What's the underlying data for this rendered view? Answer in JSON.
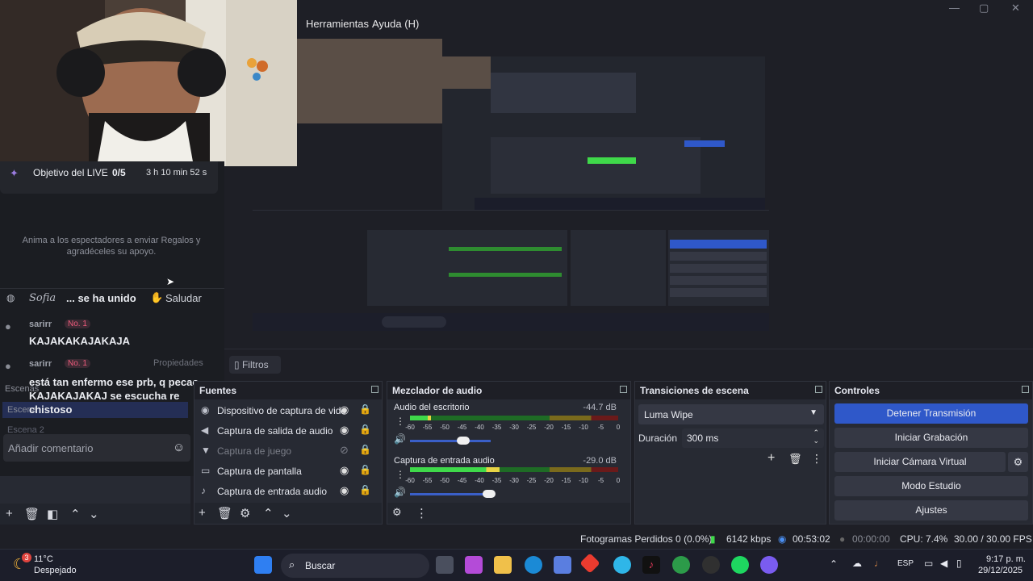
{
  "window": {
    "menu": [
      "Herramientas",
      "Ayuda (H)"
    ],
    "controls": [
      "—",
      "▢",
      "✕"
    ]
  },
  "chat": {
    "goal_label": "Objetivo del LIVE",
    "goal_progress": "0/5",
    "goal_timer": "3 h 10 min 52 s",
    "gift_prompt": "Anima a los espectadores a enviar Regalos y agradéceles su apoyo.",
    "joined_user": "Sofia",
    "joined_text": "... se ha unido",
    "greet_button": "Saludar",
    "messages": [
      {
        "user": "sarirr",
        "badge": "No. 1",
        "text": "KAJAKAKAJAKAJA"
      },
      {
        "user": "sarirr",
        "badge": "No. 1",
        "text": "está tan enfermo ese prb, q pecao KAJAKAJAKAJ se escucha re chistoso"
      }
    ],
    "comment_placeholder": "Añadir comentario",
    "hidden_labels": {
      "scenes": "Escenas",
      "scene1": "Escena",
      "scene2": "Escena 2",
      "properties": "Propiedades"
    }
  },
  "filtros": {
    "label": "Filtros"
  },
  "sources": {
    "title": "Fuentes",
    "items": [
      {
        "label": "Dispositivo de captura de vide",
        "icon": "camera-icon"
      },
      {
        "label": "Captura de salida de audio",
        "icon": "speaker-icon"
      },
      {
        "label": "Captura de juego",
        "icon": "gamepad-icon"
      },
      {
        "label": "Captura de pantalla",
        "icon": "monitor-icon"
      },
      {
        "label": "Captura de entrada audio",
        "icon": "mic-icon"
      }
    ]
  },
  "mixer": {
    "title": "Mezclador de audio",
    "channels": [
      {
        "name": "Audio del escritorio",
        "db": "-44.7 dB",
        "level": 0.1
      },
      {
        "name": "Captura de entrada audio",
        "db": "-29.0 dB",
        "level": 0.43
      }
    ],
    "scale": [
      "-60",
      "-55",
      "-50",
      "-45",
      "-40",
      "-35",
      "-30",
      "-25",
      "-20",
      "-15",
      "-10",
      "-5",
      "0"
    ]
  },
  "transitions": {
    "title": "Transiciones de escena",
    "selected": "Luma Wipe",
    "duration_label": "Duración",
    "duration_value": "300 ms"
  },
  "controls": {
    "title": "Controles",
    "buttons": [
      "Detener Transmisión",
      "Iniciar Grabación",
      "Iniciar Cámara Virtual",
      "Modo Estudio",
      "Ajustes"
    ]
  },
  "status": {
    "frames": "Fotogramas Perdidos 0 (0.0%)",
    "bitrate": "6142 kbps",
    "stream_time": "00:53:02",
    "rec_time": "00:00:00",
    "cpu": "CPU: 7.4%",
    "fps": "30.00 / 30.00 FPS"
  },
  "taskbar": {
    "weather_badge": "3",
    "temp": "11°C",
    "condition": "Despejado",
    "search": "Buscar",
    "lang": "ESP",
    "time": "9:17 p. m.",
    "date": "29/12/2025"
  },
  "colors": {
    "accent": "#2f58c9",
    "panel": "#272a33",
    "bg": "#1e1f26"
  }
}
